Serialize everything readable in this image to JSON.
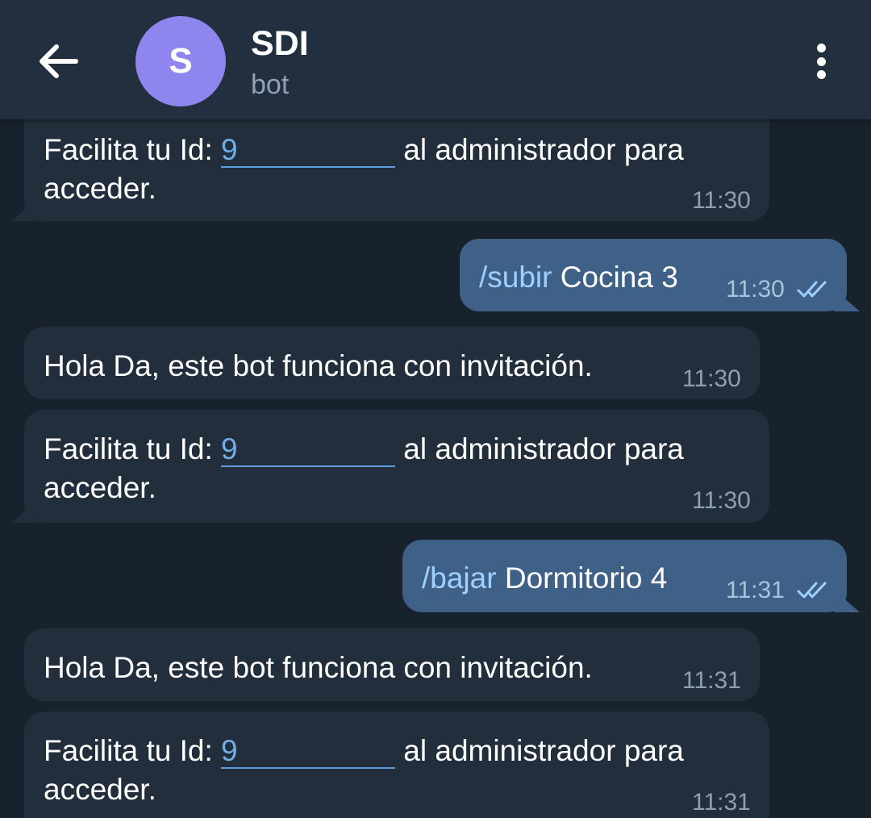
{
  "header": {
    "title": "SDI",
    "status": "bot",
    "avatar_letter": "S",
    "avatar_color": "#8e85ee",
    "back_icon": "arrow-left-icon",
    "menu_icon": "more-vertical-icon"
  },
  "messages": [
    {
      "direction": "in",
      "pre": "Facilita tu Id: ",
      "link": "9",
      "post": " al administrador para",
      "line2": "acceder.",
      "time": "11:30"
    },
    {
      "direction": "out",
      "command": "/subir",
      "text": " Cocina 3",
      "time": "11:30",
      "status_icon": "double-check-icon"
    },
    {
      "direction": "in",
      "text": "Hola Da, este bot funciona con invitación.",
      "time": "11:30"
    },
    {
      "direction": "in",
      "pre": "Facilita tu Id: ",
      "link": "9",
      "post": " al administrador para",
      "line2": "acceder.",
      "time": "11:30"
    },
    {
      "direction": "out",
      "command": "/bajar",
      "text": " Dormitorio 4",
      "time": "11:31",
      "status_icon": "double-check-icon"
    },
    {
      "direction": "in",
      "text": "Hola Da, este bot funciona con invitación.",
      "time": "11:31"
    },
    {
      "direction": "in",
      "pre": "Facilita tu Id: ",
      "link": "9",
      "post": " al administrador para",
      "line2": "acceder.",
      "time": "11:31"
    }
  ],
  "colors": {
    "background": "#18222d",
    "header": "#222f3e",
    "incoming_bubble": "#222e3b",
    "outgoing_bubble": "#3f6188",
    "link": "#71aee9"
  }
}
